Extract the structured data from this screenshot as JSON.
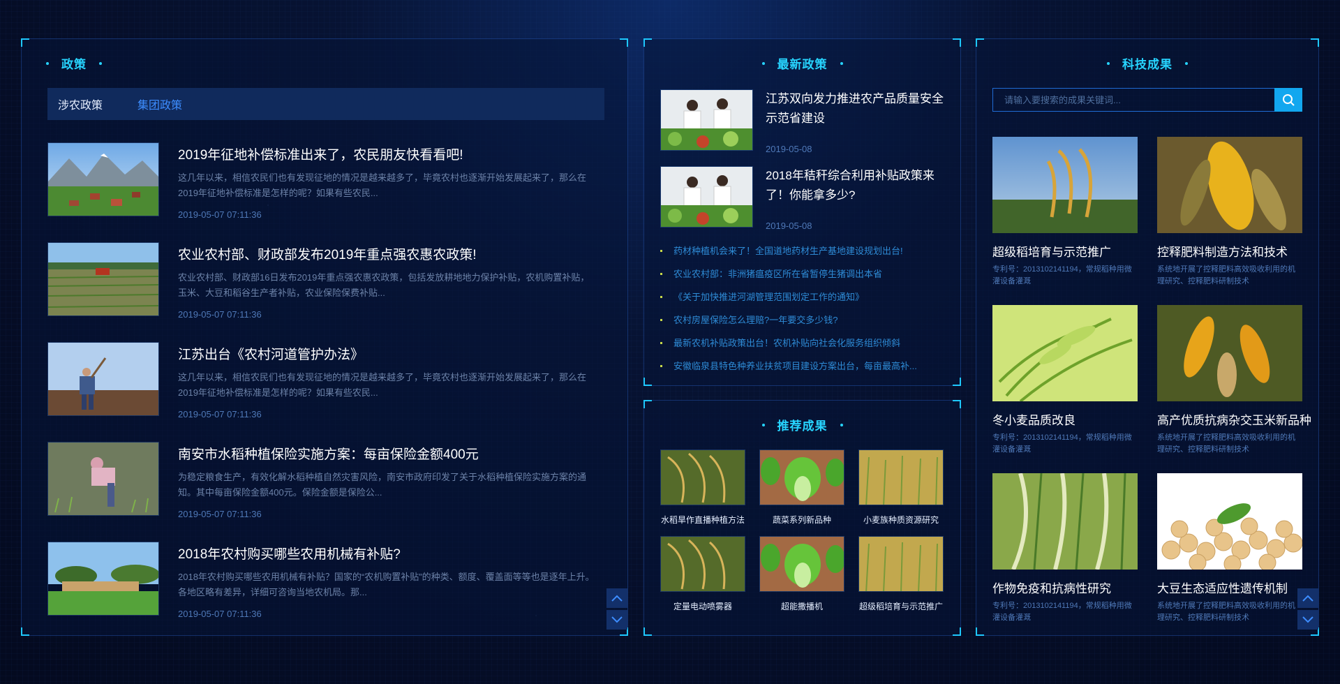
{
  "policy_panel": {
    "title": "政策",
    "tabs": [
      "涉农政策",
      "集团政策"
    ],
    "news": [
      {
        "title": "2019年征地补偿标准出来了，农民朋友快看看吧!",
        "desc": "这几年以来，相信农民们也有发现征地的情况是越来越多了，毕竟农村也逐渐开始发展起来了，那么在2019年征地补偿标准是怎样的呢？如果有些农民...",
        "time": "2019-05-07 07:11:36"
      },
      {
        "title": "农业农村部、财政部发布2019年重点强农惠农政策!",
        "desc": "农业农村部、财政部16日发布2019年重点强农惠农政策，包括发放耕地地力保护补贴，农机购置补贴，玉米、大豆和稻谷生产者补贴，农业保险保费补贴...",
        "time": "2019-05-07 07:11:36"
      },
      {
        "title": "江苏出台《农村河道管护办法》",
        "desc": "这几年以来，相信农民们也有发现征地的情况是越来越多了，毕竟农村也逐渐开始发展起来了，那么在2019年征地补偿标准是怎样的呢？如果有些农民...",
        "time": "2019-05-07 07:11:36"
      },
      {
        "title": "南安市水稻种植保险实施方案：每亩保险金额400元",
        "desc": "为稳定粮食生产，有效化解水稻种植自然灾害风险，南安市政府印发了关于水稻种植保险实施方案的通知。其中每亩保险金额400元。保险金额是保险公...",
        "time": "2019-05-07 07:11:36"
      },
      {
        "title": "2018年农村购买哪些农用机械有补贴?",
        "desc": "2018年农村购买哪些农用机械有补贴？国家的“农机购置补贴”的种类、额度、覆盖面等等也是逐年上升。各地区略有差异，详细可咨询当地农机局。那...",
        "time": "2019-05-07 07:11:36"
      }
    ]
  },
  "latest_panel": {
    "title": "最新政策",
    "items": [
      {
        "title": "江苏双向发力推进农产品质量安全示范省建设",
        "time": "2019-05-08"
      },
      {
        "title": "2018年秸秆综合利用补贴政策来了！你能拿多少?",
        "time": "2019-05-08"
      }
    ],
    "links": [
      "药材种植机会来了！全国道地药材生产基地建设规划出台!",
      "农业农村部：非洲猪瘟疫区所在省暂停生猪调出本省",
      "《关于加快推进河湖管理范围划定工作的通知》",
      "农村房屋保险怎么理赔?一年要交多少钱?",
      "最新农机补贴政策出台！农机补贴向社会化服务组织倾斜",
      "安徽临泉县特色种养业扶贫项目建设方案出台，每亩最高补..."
    ]
  },
  "recommend_panel": {
    "title": "推荐成果",
    "items": [
      "水稻旱作直播种植方法",
      "蔬菜系列新品种",
      "小麦族种质资源研究",
      "定量电动喷雾器",
      "超能撒播机",
      "超级稻培育与示范推广"
    ]
  },
  "achievement_panel": {
    "title": "科技成果",
    "search_placeholder": "请输入要搜索的成果关键词...",
    "items": [
      {
        "title": "超级稻培育与示范推广",
        "desc": "专利号：2013102141194，常规稻种用微灌设备灌溉"
      },
      {
        "title": "控释肥料制造方法和技术",
        "desc": "系统地开展了控释肥料高效吸收利用的机理研究、控释肥料研制技术"
      },
      {
        "title": "冬小麦品质改良",
        "desc": "专利号：2013102141194，常规稻种用微灌设备灌溉"
      },
      {
        "title": "高产优质抗病杂交玉米新品种",
        "desc": "系统地开展了控释肥料高效吸收利用的机理研究、控释肥料研制技术"
      },
      {
        "title": "作物免疫和抗病性研究",
        "desc": "专利号：2013102141194，常规稻种用微灌设备灌溉"
      },
      {
        "title": "大豆生态适应性遗传机制",
        "desc": "系统地开展了控释肥料高效吸收利用的机理研究、控释肥料研制技术"
      }
    ]
  },
  "icons": {
    "scroll_up": "chevron-up-icon",
    "scroll_down": "chevron-down-icon",
    "search": "search-icon"
  },
  "colors": {
    "accent": "#27d4ff",
    "link": "#2e8bd6",
    "active_tab": "#3d8dff",
    "search_button": "#12a7ef"
  }
}
